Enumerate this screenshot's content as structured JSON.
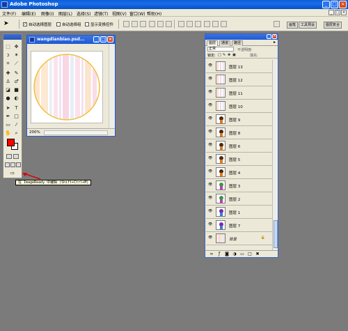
{
  "app": {
    "title": "Adobe Photoshop",
    "window_buttons": [
      "_",
      "□",
      "×"
    ]
  },
  "menu": {
    "items": [
      "文件(F)",
      "编辑(E)",
      "图像(I)",
      "图层(L)",
      "选择(S)",
      "滤镜(T)",
      "视图(V)",
      "窗口(W)",
      "帮助(H)"
    ]
  },
  "options_bar": {
    "auto_select_layer": "自动选择图层",
    "auto_select_group": "自动选择组",
    "show_transform": "显示变换控件",
    "palette_tabs": [
      "画笔",
      "工具预设",
      "图层复合"
    ]
  },
  "document": {
    "title": "wangdianbiao.psd...",
    "zoom": "200%"
  },
  "tooltip": {
    "text": "在 ImageReady 中编辑 (Shift+Ctrl+M)"
  },
  "layers_panel": {
    "tabs": [
      "图层",
      "通道",
      "路径"
    ],
    "blend_mode": "正常",
    "opacity_label": "不透明度:",
    "lock_label": "锁定:",
    "fill_label": "填充:",
    "layers": [
      {
        "name": "图层 13",
        "thumb": "stripes"
      },
      {
        "name": "图层 12",
        "thumb": "stripes"
      },
      {
        "name": "图层 11",
        "thumb": "stripes"
      },
      {
        "name": "图层 10",
        "thumb": "stripes"
      },
      {
        "name": "图层 9",
        "thumb": "character-orange"
      },
      {
        "name": "图层 8",
        "thumb": "character-orange"
      },
      {
        "name": "图层 6",
        "thumb": "character-orange"
      },
      {
        "name": "图层 5",
        "thumb": "character-orange"
      },
      {
        "name": "图层 4",
        "thumb": "character-orange"
      },
      {
        "name": "图层 3",
        "thumb": "character-green"
      },
      {
        "name": "图层 2",
        "thumb": "character-green"
      },
      {
        "name": "图层 1",
        "thumb": "character-purple"
      },
      {
        "name": "图层 7",
        "thumb": "character-purple"
      },
      {
        "name": "背景",
        "thumb": "background",
        "locked": true
      }
    ]
  },
  "colors": {
    "foreground": "#ff0000",
    "background": "#ffffff",
    "circle_stroke": "#f0c040"
  }
}
